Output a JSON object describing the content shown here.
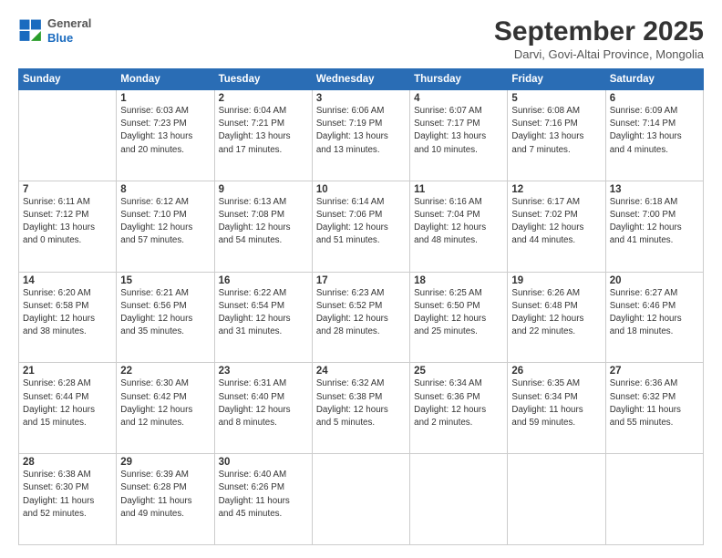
{
  "logo": {
    "general": "General",
    "blue": "Blue"
  },
  "header": {
    "month": "September 2025",
    "location": "Darvi, Govi-Altai Province, Mongolia"
  },
  "days": [
    "Sunday",
    "Monday",
    "Tuesday",
    "Wednesday",
    "Thursday",
    "Friday",
    "Saturday"
  ],
  "weeks": [
    [
      {
        "day": "",
        "content": ""
      },
      {
        "day": "1",
        "content": "Sunrise: 6:03 AM\nSunset: 7:23 PM\nDaylight: 13 hours\nand 20 minutes."
      },
      {
        "day": "2",
        "content": "Sunrise: 6:04 AM\nSunset: 7:21 PM\nDaylight: 13 hours\nand 17 minutes."
      },
      {
        "day": "3",
        "content": "Sunrise: 6:06 AM\nSunset: 7:19 PM\nDaylight: 13 hours\nand 13 minutes."
      },
      {
        "day": "4",
        "content": "Sunrise: 6:07 AM\nSunset: 7:17 PM\nDaylight: 13 hours\nand 10 minutes."
      },
      {
        "day": "5",
        "content": "Sunrise: 6:08 AM\nSunset: 7:16 PM\nDaylight: 13 hours\nand 7 minutes."
      },
      {
        "day": "6",
        "content": "Sunrise: 6:09 AM\nSunset: 7:14 PM\nDaylight: 13 hours\nand 4 minutes."
      }
    ],
    [
      {
        "day": "7",
        "content": "Sunrise: 6:11 AM\nSunset: 7:12 PM\nDaylight: 13 hours\nand 0 minutes."
      },
      {
        "day": "8",
        "content": "Sunrise: 6:12 AM\nSunset: 7:10 PM\nDaylight: 12 hours\nand 57 minutes."
      },
      {
        "day": "9",
        "content": "Sunrise: 6:13 AM\nSunset: 7:08 PM\nDaylight: 12 hours\nand 54 minutes."
      },
      {
        "day": "10",
        "content": "Sunrise: 6:14 AM\nSunset: 7:06 PM\nDaylight: 12 hours\nand 51 minutes."
      },
      {
        "day": "11",
        "content": "Sunrise: 6:16 AM\nSunset: 7:04 PM\nDaylight: 12 hours\nand 48 minutes."
      },
      {
        "day": "12",
        "content": "Sunrise: 6:17 AM\nSunset: 7:02 PM\nDaylight: 12 hours\nand 44 minutes."
      },
      {
        "day": "13",
        "content": "Sunrise: 6:18 AM\nSunset: 7:00 PM\nDaylight: 12 hours\nand 41 minutes."
      }
    ],
    [
      {
        "day": "14",
        "content": "Sunrise: 6:20 AM\nSunset: 6:58 PM\nDaylight: 12 hours\nand 38 minutes."
      },
      {
        "day": "15",
        "content": "Sunrise: 6:21 AM\nSunset: 6:56 PM\nDaylight: 12 hours\nand 35 minutes."
      },
      {
        "day": "16",
        "content": "Sunrise: 6:22 AM\nSunset: 6:54 PM\nDaylight: 12 hours\nand 31 minutes."
      },
      {
        "day": "17",
        "content": "Sunrise: 6:23 AM\nSunset: 6:52 PM\nDaylight: 12 hours\nand 28 minutes."
      },
      {
        "day": "18",
        "content": "Sunrise: 6:25 AM\nSunset: 6:50 PM\nDaylight: 12 hours\nand 25 minutes."
      },
      {
        "day": "19",
        "content": "Sunrise: 6:26 AM\nSunset: 6:48 PM\nDaylight: 12 hours\nand 22 minutes."
      },
      {
        "day": "20",
        "content": "Sunrise: 6:27 AM\nSunset: 6:46 PM\nDaylight: 12 hours\nand 18 minutes."
      }
    ],
    [
      {
        "day": "21",
        "content": "Sunrise: 6:28 AM\nSunset: 6:44 PM\nDaylight: 12 hours\nand 15 minutes."
      },
      {
        "day": "22",
        "content": "Sunrise: 6:30 AM\nSunset: 6:42 PM\nDaylight: 12 hours\nand 12 minutes."
      },
      {
        "day": "23",
        "content": "Sunrise: 6:31 AM\nSunset: 6:40 PM\nDaylight: 12 hours\nand 8 minutes."
      },
      {
        "day": "24",
        "content": "Sunrise: 6:32 AM\nSunset: 6:38 PM\nDaylight: 12 hours\nand 5 minutes."
      },
      {
        "day": "25",
        "content": "Sunrise: 6:34 AM\nSunset: 6:36 PM\nDaylight: 12 hours\nand 2 minutes."
      },
      {
        "day": "26",
        "content": "Sunrise: 6:35 AM\nSunset: 6:34 PM\nDaylight: 11 hours\nand 59 minutes."
      },
      {
        "day": "27",
        "content": "Sunrise: 6:36 AM\nSunset: 6:32 PM\nDaylight: 11 hours\nand 55 minutes."
      }
    ],
    [
      {
        "day": "28",
        "content": "Sunrise: 6:38 AM\nSunset: 6:30 PM\nDaylight: 11 hours\nand 52 minutes."
      },
      {
        "day": "29",
        "content": "Sunrise: 6:39 AM\nSunset: 6:28 PM\nDaylight: 11 hours\nand 49 minutes."
      },
      {
        "day": "30",
        "content": "Sunrise: 6:40 AM\nSunset: 6:26 PM\nDaylight: 11 hours\nand 45 minutes."
      },
      {
        "day": "",
        "content": ""
      },
      {
        "day": "",
        "content": ""
      },
      {
        "day": "",
        "content": ""
      },
      {
        "day": "",
        "content": ""
      }
    ]
  ]
}
